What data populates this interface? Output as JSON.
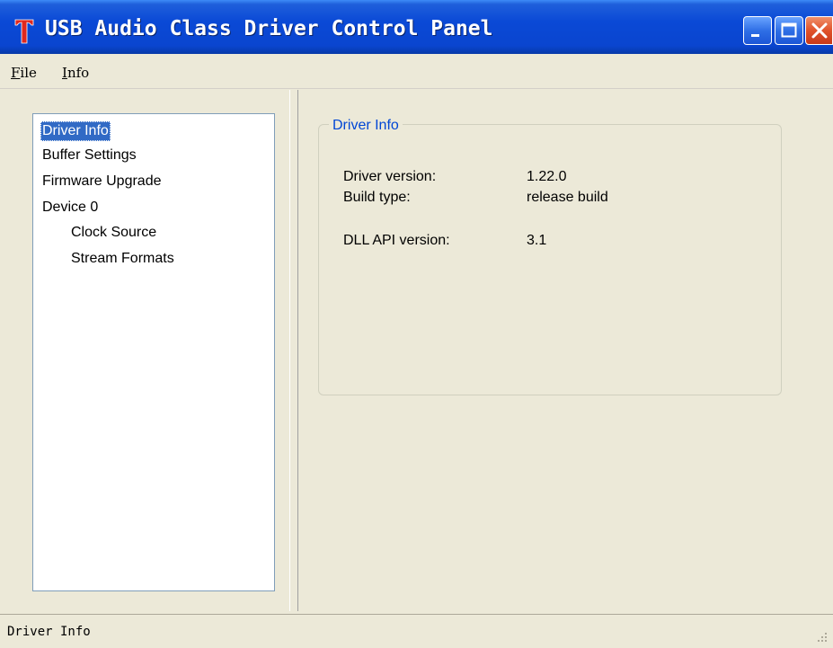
{
  "window": {
    "title": "USB Audio Class Driver Control Panel",
    "logo_letter": "T",
    "accent_color": "#0a49d6",
    "logo_color": "#e0281e"
  },
  "menu": {
    "file_mnemonic": "F",
    "file_rest": "ile",
    "info_mnemonic": "I",
    "info_rest": "nfo"
  },
  "tree": {
    "items": [
      {
        "label": "Driver Info",
        "selected": true,
        "indent": 0
      },
      {
        "label": "Buffer Settings",
        "selected": false,
        "indent": 0
      },
      {
        "label": "Firmware Upgrade",
        "selected": false,
        "indent": 0
      },
      {
        "label": "Device 0",
        "selected": false,
        "indent": 0
      },
      {
        "label": "Clock Source",
        "selected": false,
        "indent": 1
      },
      {
        "label": "Stream Formats",
        "selected": false,
        "indent": 1
      }
    ]
  },
  "panel": {
    "group_title": "Driver Info",
    "rows": [
      {
        "label": "Driver version:",
        "value": "1.22.0"
      },
      {
        "label": "Build type:",
        "value": "release build"
      },
      {
        "label": "DLL API version:",
        "value": "3.1"
      }
    ]
  },
  "status": {
    "text": "Driver Info"
  }
}
